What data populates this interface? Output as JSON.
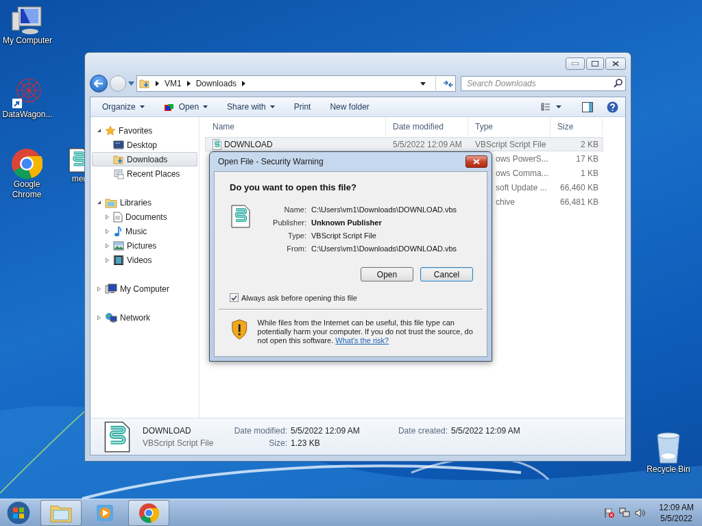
{
  "desktop_icons": [
    {
      "label": "My Computer",
      "kind": "computer"
    },
    {
      "label": "DataWagon...",
      "kind": "web"
    },
    {
      "label": "Google Chrome",
      "kind": "chrome"
    },
    {
      "label": "mer",
      "kind": "script"
    },
    {
      "label": "Recycle Bin",
      "kind": "bin"
    }
  ],
  "explorer": {
    "breadcrumb": [
      "VM1",
      "Downloads"
    ],
    "search": {
      "placeholder": "Search Downloads"
    },
    "toolbar": [
      {
        "label": "Organize",
        "dropdown": true,
        "kind": "plain"
      },
      {
        "label": "Open",
        "dropdown": true,
        "kind": "open"
      },
      {
        "label": "Share with",
        "dropdown": true,
        "kind": "plain"
      },
      {
        "label": "Print",
        "dropdown": false,
        "kind": "plain"
      },
      {
        "label": "New folder",
        "dropdown": false,
        "kind": "plain"
      }
    ],
    "sidebar": [
      {
        "label": "Favorites",
        "kind": "star",
        "expanded": true,
        "selected": false,
        "children": [
          {
            "label": "Desktop",
            "kind": "desktop",
            "selected": false
          },
          {
            "label": "Downloads",
            "kind": "downloads",
            "selected": true
          },
          {
            "label": "Recent Places",
            "kind": "recent",
            "selected": false
          }
        ]
      },
      {
        "label": "Libraries",
        "kind": "libraries",
        "expanded": true,
        "selected": false,
        "children": [
          {
            "label": "Documents",
            "kind": "document",
            "expanded": false,
            "selected": false
          },
          {
            "label": "Music",
            "kind": "music",
            "expanded": false,
            "selected": false
          },
          {
            "label": "Pictures",
            "kind": "pictures",
            "expanded": false,
            "selected": false
          },
          {
            "label": "Videos",
            "kind": "videos",
            "expanded": false,
            "selected": false
          }
        ]
      },
      {
        "label": "My Computer",
        "kind": "computer",
        "expanded": false,
        "selected": false
      },
      {
        "label": "Network",
        "kind": "network",
        "expanded": false,
        "selected": false
      }
    ],
    "columns": [
      "Name",
      "Date modified",
      "Type",
      "Size"
    ],
    "rows": [
      {
        "name": "DOWNLOAD",
        "date": "5/5/2022 12:09 AM",
        "type": "VBScript Script File",
        "size": "2 KB",
        "selected": true
      },
      {
        "type": "ows PowerS...",
        "size": "17 KB",
        "selected": false
      },
      {
        "type": "ows Comma...",
        "size": "1 KB",
        "selected": false
      },
      {
        "type": "soft Update ...",
        "size": "66,460 KB",
        "selected": false
      },
      {
        "type": "chive",
        "size": "66,481 KB",
        "selected": false
      }
    ],
    "details": {
      "name": "DOWNLOAD",
      "type": "VBScript Script File",
      "fields": [
        {
          "label": "Date modified:",
          "value": "5/5/2022 12:09 AM"
        },
        {
          "label": "Size:",
          "value": "1.23 KB"
        },
        {
          "label": "Date created:",
          "value": "5/5/2022 12:09 AM"
        }
      ]
    }
  },
  "dialog": {
    "title": "Open File - Security Warning",
    "question": "Do you want to open this file?",
    "fields": [
      {
        "label": "Name:",
        "value": "C:\\Users\\vm1\\Downloads\\DOWNLOAD.vbs",
        "emphasis": false
      },
      {
        "label": "Publisher:",
        "value": "Unknown Publisher",
        "emphasis": true
      },
      {
        "label": "Type:",
        "value": "VBScript Script File",
        "emphasis": false
      },
      {
        "label": "From:",
        "value": "C:\\Users\\vm1\\Downloads\\DOWNLOAD.vbs",
        "emphasis": false
      }
    ],
    "buttons": [
      {
        "label": "Open",
        "default": false
      },
      {
        "label": "Cancel",
        "default": true
      }
    ],
    "checkbox": {
      "label": "Always ask before opening this file",
      "checked": true
    },
    "warning": {
      "text": "While files from the Internet can be useful, this file type can potentially harm your computer. If you do not trust the source, do not open this software.",
      "link": "What's the risk?"
    }
  },
  "taskbar": {
    "items": [
      {
        "kind": "explorer",
        "running": true
      },
      {
        "kind": "media",
        "running": false
      },
      {
        "kind": "chrome",
        "running": true
      }
    ],
    "time": "12:09 AM",
    "date": "5/5/2022"
  }
}
